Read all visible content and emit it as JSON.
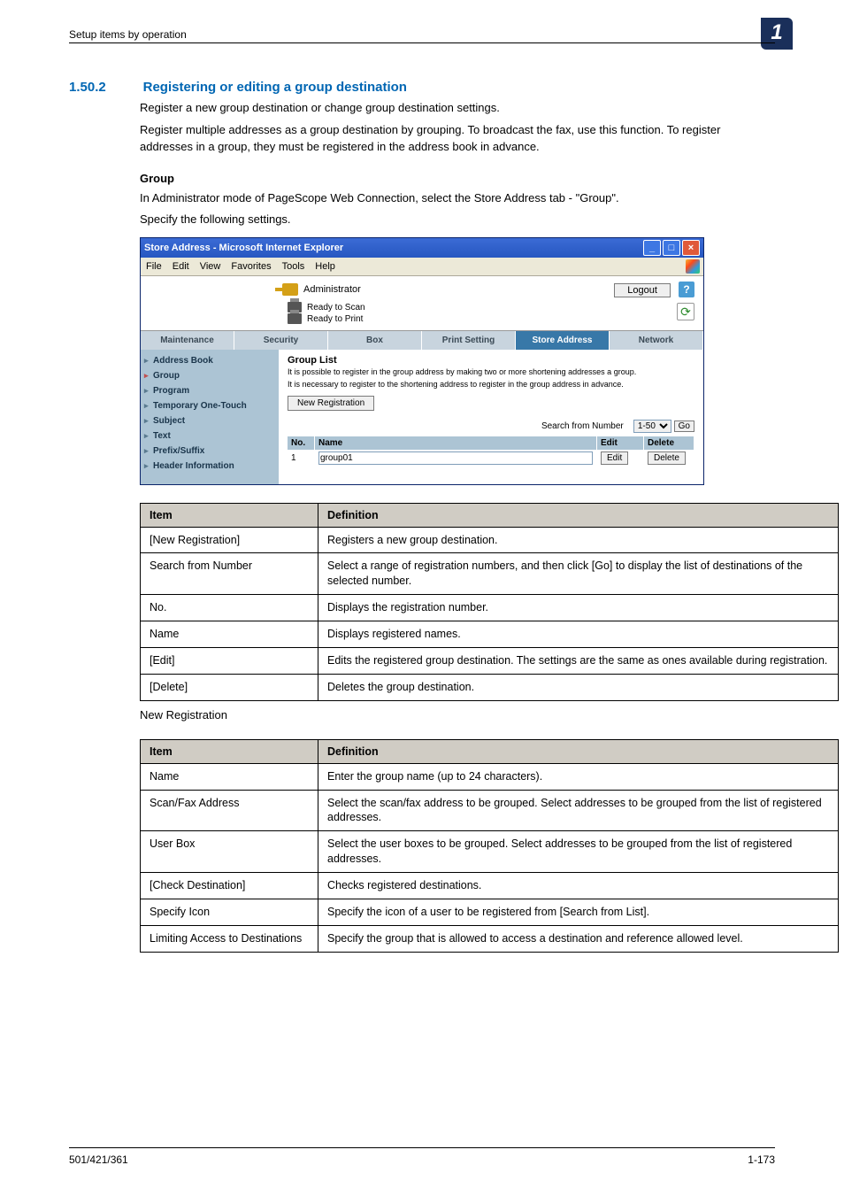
{
  "header": {
    "breadcrumb": "Setup items by operation",
    "chapter": "1"
  },
  "section": {
    "number": "1.50.2",
    "title": "Registering or editing a group destination",
    "para1": "Register a new group destination or change group destination settings.",
    "para2": "Register multiple addresses as a group destination by grouping. To broadcast the fax, use this function. To register addresses in a group, they must be registered in the address book in advance.",
    "sub1": "Group",
    "para3": "In Administrator mode of PageScope Web Connection, select the Store Address tab - \"Group\".",
    "para4": "Specify the following settings."
  },
  "ie": {
    "title": "Store Address - Microsoft Internet Explorer",
    "menus": [
      "File",
      "Edit",
      "View",
      "Favorites",
      "Tools",
      "Help"
    ],
    "admin_label": "Administrator",
    "logout": "Logout",
    "status_scan": "Ready to Scan",
    "status_print": "Ready to Print",
    "tabs": [
      "Maintenance",
      "Security",
      "Box",
      "Print Setting",
      "Store Address",
      "Network"
    ],
    "active_tab": 4,
    "sidebar": [
      "Address Book",
      "Group",
      "Program",
      "Temporary One-Touch",
      "Subject",
      "Text",
      "Prefix/Suffix",
      "Header Information"
    ],
    "sidebar_active": 1,
    "main": {
      "title": "Group List",
      "desc1": "It is possible to register in the group address by making two or more shortening addresses a group.",
      "desc2": "It is necessary to register to the shortening address to register in the group address in advance.",
      "new_reg": "New Registration",
      "search_label": "Search from Number",
      "range": "1-50",
      "go": "Go",
      "head_no": "No.",
      "head_name": "Name",
      "head_edit": "Edit",
      "head_delete": "Delete",
      "row_no": "1",
      "row_name": "group01",
      "row_edit": "Edit",
      "row_delete": "Delete"
    }
  },
  "table1": {
    "h1": "Item",
    "h2": "Definition",
    "rows": [
      {
        "item": "[New Registration]",
        "def": "Registers a new group destination."
      },
      {
        "item": "Search from Number",
        "def": "Select a range of registration numbers, and then click [Go] to display the list of destinations of the selected number."
      },
      {
        "item": "No.",
        "def": "Displays the registration number."
      },
      {
        "item": "Name",
        "def": "Displays registered names."
      },
      {
        "item": "[Edit]",
        "def": "Edits the registered group destination. The settings are the same as ones available during registration."
      },
      {
        "item": "[Delete]",
        "def": "Deletes the group destination."
      }
    ]
  },
  "caption_newreg": "New Registration",
  "table2": {
    "h1": "Item",
    "h2": "Definition",
    "rows": [
      {
        "item": "Name",
        "def": "Enter the group name (up to 24 characters)."
      },
      {
        "item": "Scan/Fax Address",
        "def": "Select the scan/fax address to be grouped. Select addresses to be grouped from the list of registered addresses."
      },
      {
        "item": "User Box",
        "def": "Select the user boxes to be grouped. Select addresses to be grouped from the list of registered addresses."
      },
      {
        "item": "[Check Destination]",
        "def": "Checks registered destinations."
      },
      {
        "item": "Specify Icon",
        "def": "Specify the icon of a user to be registered from [Search from List]."
      },
      {
        "item": "Limiting Access to Destinations",
        "def": "Specify the group that is allowed to access a destination and reference allowed level."
      }
    ]
  },
  "footer": {
    "left": "501/421/361",
    "right": "1-173"
  }
}
